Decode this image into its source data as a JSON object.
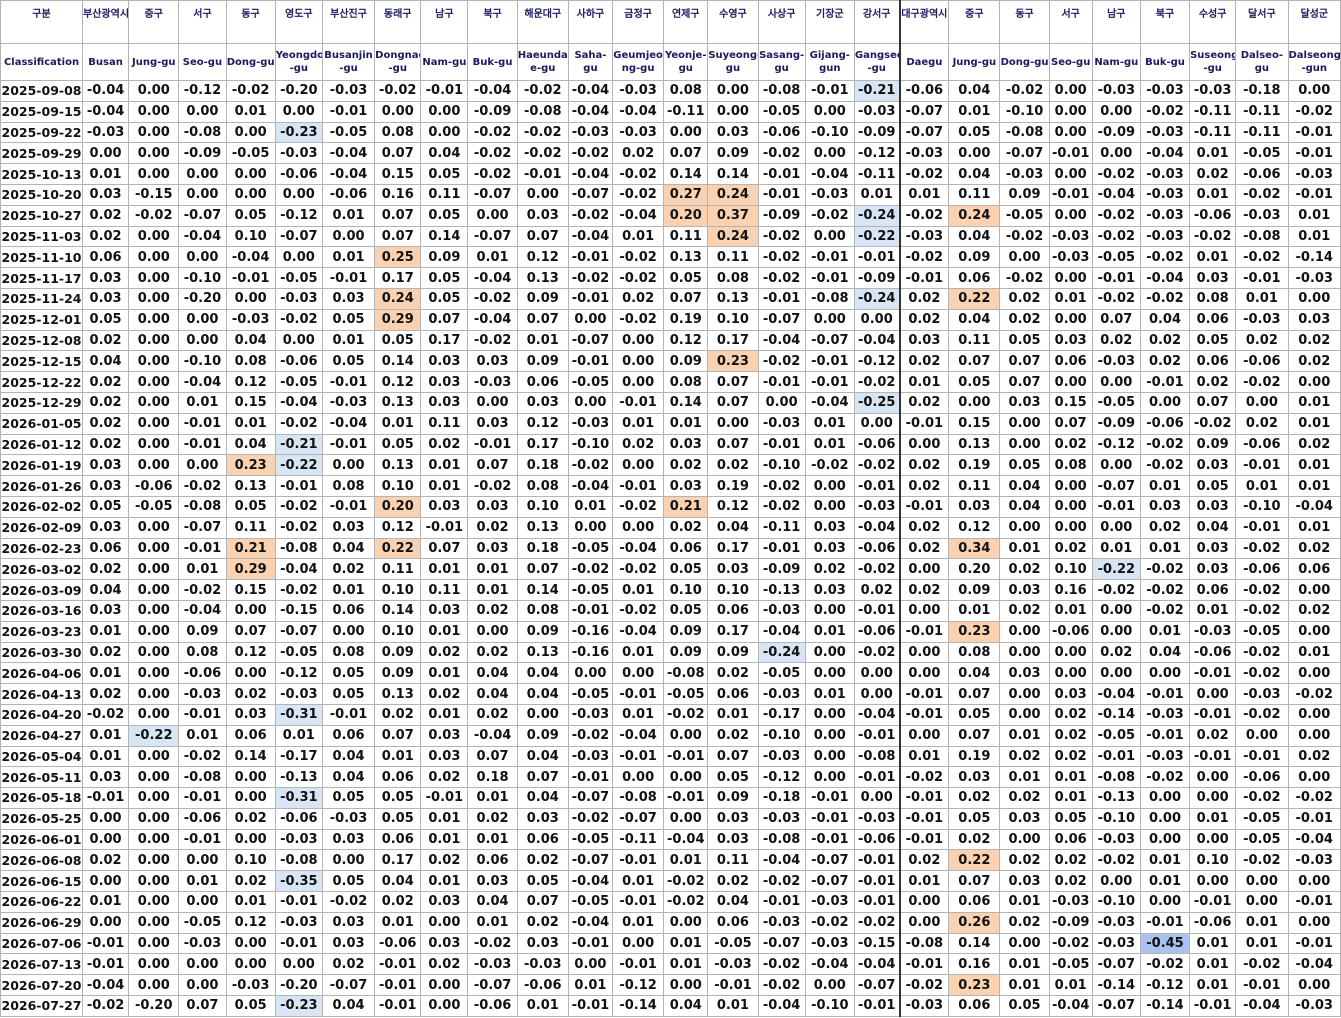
{
  "header_ko": [
    "구분",
    "부산광역시",
    "중구",
    "서구",
    "동구",
    "영도구",
    "부산진구",
    "동래구",
    "남구",
    "북구",
    "해운대구",
    "사하구",
    "금정구",
    "연제구",
    "수영구",
    "사상구",
    "기장군",
    "강서구",
    "대구광역시",
    "중구",
    "동구",
    "서구",
    "남구",
    "북구",
    "수성구",
    "달서구",
    "달성군"
  ],
  "header_en": [
    "Classification",
    "Busan",
    "Jung-gu",
    "Seo-gu",
    "Dong-gu",
    "Yeongdo -gu",
    "Busanjin -gu",
    "Dongnae -gu",
    "Nam-gu",
    "Buk-gu",
    "Haeunda e-gu",
    "Saha-gu",
    "Geumjeo ng-gu",
    "Yeonje- gu",
    "Suyeong- gu",
    "Sasang- gu",
    "Gijang- gun",
    "Gangseo -gu",
    "Daegu",
    "Jung-gu",
    "Dong-gu",
    "Seo-gu",
    "Nam-gu",
    "Buk-gu",
    "Suseong -gu",
    "Dalseo- gu",
    "Dalseong -gun"
  ],
  "rows": [
    [
      "2025-09-08",
      "-0.04",
      "0.00",
      "-0.12",
      "-0.02",
      "-0.20",
      "-0.03",
      "-0.02",
      "-0.01",
      "-0.04",
      "-0.02",
      "-0.04",
      "-0.03",
      "0.08",
      "0.00",
      "-0.08",
      "-0.01",
      "-0.21",
      "-0.06",
      "0.04",
      "-0.02",
      "0.00",
      "-0.03",
      "-0.03",
      "-0.03",
      "-0.18",
      "0.00"
    ],
    [
      "2025-09-15",
      "-0.04",
      "0.00",
      "0.00",
      "0.01",
      "0.00",
      "-0.01",
      "0.00",
      "0.00",
      "-0.09",
      "-0.08",
      "-0.04",
      "-0.04",
      "-0.11",
      "0.00",
      "-0.05",
      "0.00",
      "-0.03",
      "-0.07",
      "0.01",
      "-0.10",
      "0.00",
      "0.00",
      "-0.02",
      "-0.11",
      "-0.11",
      "-0.02"
    ],
    [
      "2025-09-22",
      "-0.03",
      "0.00",
      "-0.08",
      "0.00",
      "-0.23",
      "-0.05",
      "0.08",
      "0.00",
      "-0.02",
      "-0.02",
      "-0.03",
      "-0.03",
      "0.00",
      "0.03",
      "-0.06",
      "-0.10",
      "-0.09",
      "-0.07",
      "0.05",
      "-0.08",
      "0.00",
      "-0.09",
      "-0.03",
      "-0.11",
      "-0.11",
      "-0.01"
    ],
    [
      "2025-09-29",
      "0.00",
      "0.00",
      "-0.09",
      "-0.05",
      "-0.03",
      "-0.04",
      "0.07",
      "0.04",
      "-0.02",
      "-0.02",
      "-0.02",
      "0.02",
      "0.07",
      "0.09",
      "-0.02",
      "0.00",
      "-0.12",
      "-0.03",
      "0.00",
      "-0.07",
      "-0.01",
      "0.00",
      "-0.04",
      "0.01",
      "-0.05",
      "-0.01"
    ],
    [
      "2025-10-13",
      "0.01",
      "0.00",
      "0.00",
      "0.00",
      "-0.06",
      "-0.04",
      "0.15",
      "0.05",
      "-0.02",
      "-0.01",
      "-0.04",
      "-0.02",
      "0.14",
      "0.14",
      "-0.01",
      "-0.04",
      "-0.11",
      "-0.02",
      "0.04",
      "-0.03",
      "0.00",
      "-0.02",
      "-0.03",
      "0.02",
      "-0.06",
      "-0.03"
    ],
    [
      "2025-10-20",
      "0.03",
      "-0.15",
      "0.00",
      "0.00",
      "0.00",
      "-0.06",
      "0.16",
      "0.11",
      "-0.07",
      "0.00",
      "-0.07",
      "-0.02",
      "0.27",
      "0.24",
      "-0.01",
      "-0.03",
      "0.01",
      "0.01",
      "0.11",
      "0.09",
      "-0.01",
      "-0.04",
      "-0.03",
      "0.01",
      "-0.02",
      "-0.01"
    ],
    [
      "2025-10-27",
      "0.02",
      "-0.02",
      "-0.07",
      "0.05",
      "-0.12",
      "0.01",
      "0.07",
      "0.05",
      "0.00",
      "0.03",
      "-0.02",
      "-0.04",
      "0.20",
      "0.37",
      "-0.09",
      "-0.02",
      "-0.24",
      "-0.02",
      "0.24",
      "-0.05",
      "0.00",
      "-0.02",
      "-0.03",
      "-0.06",
      "-0.03",
      "0.01"
    ],
    [
      "2025-11-03",
      "0.02",
      "0.00",
      "-0.04",
      "0.10",
      "-0.07",
      "0.00",
      "0.07",
      "0.14",
      "-0.07",
      "0.07",
      "-0.04",
      "0.01",
      "0.11",
      "0.24",
      "-0.02",
      "0.00",
      "-0.22",
      "-0.03",
      "0.04",
      "-0.02",
      "-0.03",
      "-0.02",
      "-0.03",
      "-0.02",
      "-0.08",
      "0.01"
    ],
    [
      "2025-11-10",
      "0.06",
      "0.00",
      "0.00",
      "-0.04",
      "0.00",
      "0.01",
      "0.25",
      "0.09",
      "0.01",
      "0.12",
      "-0.01",
      "-0.02",
      "0.13",
      "0.11",
      "-0.02",
      "-0.01",
      "-0.01",
      "-0.02",
      "0.09",
      "0.00",
      "-0.03",
      "-0.05",
      "-0.02",
      "0.01",
      "-0.02",
      "-0.14"
    ],
    [
      "2025-11-17",
      "0.03",
      "0.00",
      "-0.10",
      "-0.01",
      "-0.05",
      "-0.01",
      "0.17",
      "0.05",
      "-0.04",
      "0.13",
      "-0.02",
      "-0.02",
      "0.05",
      "0.08",
      "-0.02",
      "-0.01",
      "-0.09",
      "-0.01",
      "0.06",
      "-0.02",
      "0.00",
      "-0.01",
      "-0.04",
      "0.03",
      "-0.01",
      "-0.03"
    ],
    [
      "2025-11-24",
      "0.03",
      "0.00",
      "-0.20",
      "0.00",
      "-0.03",
      "0.03",
      "0.24",
      "0.05",
      "-0.02",
      "0.09",
      "-0.01",
      "0.02",
      "0.07",
      "0.13",
      "-0.01",
      "-0.08",
      "-0.24",
      "0.02",
      "0.22",
      "0.02",
      "0.01",
      "-0.02",
      "-0.02",
      "0.08",
      "0.01",
      "0.00"
    ],
    [
      "2025-12-01",
      "0.05",
      "0.00",
      "0.00",
      "-0.03",
      "-0.02",
      "0.05",
      "0.29",
      "0.07",
      "-0.04",
      "0.07",
      "0.00",
      "-0.02",
      "0.19",
      "0.10",
      "-0.07",
      "0.00",
      "0.00",
      "0.02",
      "0.04",
      "0.02",
      "0.00",
      "0.07",
      "0.04",
      "0.06",
      "-0.03",
      "0.03"
    ],
    [
      "2025-12-08",
      "0.02",
      "0.00",
      "0.00",
      "0.04",
      "0.00",
      "0.01",
      "0.05",
      "0.17",
      "-0.02",
      "0.01",
      "-0.07",
      "0.00",
      "0.12",
      "0.17",
      "-0.04",
      "-0.07",
      "-0.04",
      "0.03",
      "0.11",
      "0.05",
      "0.03",
      "0.02",
      "0.02",
      "0.05",
      "0.02",
      "0.02"
    ],
    [
      "2025-12-15",
      "0.04",
      "0.00",
      "-0.10",
      "0.08",
      "-0.06",
      "0.05",
      "0.14",
      "0.03",
      "0.03",
      "0.09",
      "-0.01",
      "0.00",
      "0.09",
      "0.23",
      "-0.02",
      "-0.01",
      "-0.12",
      "0.02",
      "0.07",
      "0.07",
      "0.06",
      "-0.03",
      "0.02",
      "0.06",
      "-0.06",
      "0.02"
    ],
    [
      "2025-12-22",
      "0.02",
      "0.00",
      "-0.04",
      "0.12",
      "-0.05",
      "-0.01",
      "0.12",
      "0.03",
      "-0.03",
      "0.06",
      "-0.05",
      "0.00",
      "0.08",
      "0.07",
      "-0.01",
      "-0.01",
      "-0.02",
      "0.01",
      "0.05",
      "0.07",
      "0.00",
      "0.00",
      "-0.01",
      "0.02",
      "-0.02",
      "0.00"
    ],
    [
      "2025-12-29",
      "0.02",
      "0.00",
      "0.01",
      "0.15",
      "-0.04",
      "-0.03",
      "0.13",
      "0.03",
      "0.00",
      "0.03",
      "0.00",
      "-0.01",
      "0.14",
      "0.07",
      "0.00",
      "-0.04",
      "-0.25",
      "0.02",
      "0.00",
      "0.03",
      "0.15",
      "-0.05",
      "0.00",
      "0.07",
      "0.00",
      "0.01"
    ],
    [
      "2026-01-05",
      "0.02",
      "0.00",
      "-0.01",
      "0.01",
      "-0.02",
      "-0.04",
      "0.01",
      "0.11",
      "0.03",
      "0.12",
      "-0.03",
      "0.01",
      "0.01",
      "0.00",
      "-0.03",
      "0.01",
      "0.00",
      "-0.01",
      "0.15",
      "0.00",
      "0.07",
      "-0.09",
      "-0.06",
      "-0.02",
      "0.02",
      "0.01"
    ],
    [
      "2026-01-12",
      "0.02",
      "0.00",
      "-0.01",
      "0.04",
      "-0.21",
      "-0.01",
      "0.05",
      "0.02",
      "-0.01",
      "0.17",
      "-0.10",
      "0.02",
      "0.03",
      "0.07",
      "-0.01",
      "0.01",
      "-0.06",
      "0.00",
      "0.13",
      "0.00",
      "0.02",
      "-0.12",
      "-0.02",
      "0.09",
      "-0.06",
      "0.02"
    ],
    [
      "2026-01-19",
      "0.03",
      "0.00",
      "0.00",
      "0.23",
      "-0.22",
      "0.00",
      "0.13",
      "0.01",
      "0.07",
      "0.18",
      "-0.02",
      "0.00",
      "0.02",
      "0.02",
      "-0.10",
      "-0.02",
      "-0.02",
      "0.02",
      "0.19",
      "0.05",
      "0.08",
      "0.00",
      "-0.02",
      "0.03",
      "-0.01",
      "0.01"
    ],
    [
      "2026-01-26",
      "0.03",
      "-0.06",
      "-0.02",
      "0.13",
      "-0.01",
      "0.08",
      "0.10",
      "0.01",
      "-0.02",
      "0.08",
      "-0.04",
      "-0.01",
      "0.03",
      "0.19",
      "-0.02",
      "0.00",
      "-0.01",
      "0.02",
      "0.11",
      "0.04",
      "0.00",
      "-0.07",
      "0.01",
      "0.05",
      "0.01",
      "0.01"
    ],
    [
      "2026-02-02",
      "0.05",
      "-0.05",
      "-0.08",
      "0.05",
      "-0.02",
      "-0.01",
      "0.20",
      "0.03",
      "0.03",
      "0.10",
      "0.01",
      "-0.02",
      "0.21",
      "0.12",
      "-0.02",
      "0.00",
      "-0.03",
      "-0.01",
      "0.03",
      "0.04",
      "0.00",
      "-0.01",
      "0.03",
      "0.03",
      "-0.10",
      "-0.04"
    ],
    [
      "2026-02-09",
      "0.03",
      "0.00",
      "-0.07",
      "0.11",
      "-0.02",
      "0.03",
      "0.12",
      "-0.01",
      "0.02",
      "0.13",
      "0.00",
      "0.00",
      "0.02",
      "0.04",
      "-0.11",
      "0.03",
      "-0.04",
      "0.02",
      "0.12",
      "0.00",
      "0.00",
      "0.00",
      "0.02",
      "0.04",
      "-0.01",
      "0.01"
    ],
    [
      "2026-02-23",
      "0.06",
      "0.00",
      "-0.01",
      "0.21",
      "-0.08",
      "0.04",
      "0.22",
      "0.07",
      "0.03",
      "0.18",
      "-0.05",
      "-0.04",
      "0.06",
      "0.17",
      "-0.01",
      "0.03",
      "-0.06",
      "0.02",
      "0.34",
      "0.01",
      "0.02",
      "0.01",
      "0.01",
      "0.03",
      "-0.02",
      "0.02"
    ],
    [
      "2026-03-02",
      "0.02",
      "0.00",
      "0.01",
      "0.29",
      "-0.04",
      "0.02",
      "0.11",
      "0.01",
      "0.01",
      "0.07",
      "-0.02",
      "-0.02",
      "0.05",
      "0.03",
      "-0.09",
      "0.02",
      "-0.02",
      "0.00",
      "0.20",
      "0.02",
      "0.10",
      "-0.22",
      "-0.02",
      "0.03",
      "-0.06",
      "0.06"
    ],
    [
      "2026-03-09",
      "0.04",
      "0.00",
      "-0.02",
      "0.15",
      "-0.02",
      "0.01",
      "0.10",
      "0.11",
      "0.01",
      "0.14",
      "-0.05",
      "0.01",
      "0.10",
      "0.10",
      "-0.13",
      "0.03",
      "0.02",
      "0.02",
      "0.09",
      "0.03",
      "0.16",
      "-0.02",
      "-0.02",
      "0.06",
      "-0.02",
      "0.00"
    ],
    [
      "2026-03-16",
      "0.03",
      "0.00",
      "-0.04",
      "0.00",
      "-0.15",
      "0.06",
      "0.14",
      "0.03",
      "0.02",
      "0.08",
      "-0.01",
      "-0.02",
      "0.05",
      "0.06",
      "-0.03",
      "0.00",
      "-0.01",
      "0.00",
      "0.01",
      "0.02",
      "0.01",
      "0.00",
      "-0.02",
      "0.01",
      "-0.02",
      "0.02"
    ],
    [
      "2026-03-23",
      "0.01",
      "0.00",
      "0.09",
      "0.07",
      "-0.07",
      "0.00",
      "0.10",
      "0.01",
      "0.00",
      "0.09",
      "-0.16",
      "-0.04",
      "0.09",
      "0.17",
      "-0.04",
      "0.01",
      "-0.06",
      "-0.01",
      "0.23",
      "0.00",
      "-0.06",
      "0.00",
      "0.01",
      "-0.03",
      "-0.05",
      "0.00"
    ],
    [
      "2026-03-30",
      "0.02",
      "0.00",
      "0.08",
      "0.12",
      "-0.05",
      "0.08",
      "0.09",
      "0.02",
      "0.02",
      "0.13",
      "-0.16",
      "0.01",
      "0.09",
      "0.09",
      "-0.24",
      "0.00",
      "-0.02",
      "0.00",
      "0.08",
      "0.00",
      "0.00",
      "0.02",
      "0.04",
      "-0.06",
      "-0.02",
      "0.01"
    ],
    [
      "2026-04-06",
      "0.01",
      "0.00",
      "-0.06",
      "0.00",
      "-0.12",
      "0.05",
      "0.09",
      "0.01",
      "0.04",
      "0.04",
      "0.00",
      "0.00",
      "-0.08",
      "0.02",
      "-0.05",
      "0.00",
      "0.00",
      "0.00",
      "0.04",
      "0.03",
      "0.00",
      "0.00",
      "0.00",
      "-0.01",
      "-0.02",
      "0.00"
    ],
    [
      "2026-04-13",
      "0.02",
      "0.00",
      "-0.03",
      "0.02",
      "-0.03",
      "0.05",
      "0.13",
      "0.02",
      "0.04",
      "0.04",
      "-0.05",
      "-0.01",
      "-0.05",
      "0.06",
      "-0.03",
      "0.01",
      "0.00",
      "-0.01",
      "0.07",
      "0.00",
      "0.03",
      "-0.04",
      "-0.01",
      "0.00",
      "-0.03",
      "-0.02"
    ],
    [
      "2026-04-20",
      "-0.02",
      "0.00",
      "-0.01",
      "0.03",
      "-0.31",
      "-0.01",
      "0.02",
      "0.01",
      "0.02",
      "0.00",
      "-0.03",
      "0.01",
      "-0.02",
      "0.01",
      "-0.17",
      "0.00",
      "-0.04",
      "-0.01",
      "0.05",
      "0.00",
      "0.02",
      "-0.14",
      "-0.03",
      "-0.01",
      "-0.02",
      "0.00"
    ],
    [
      "2026-04-27",
      "0.01",
      "-0.22",
      "0.01",
      "0.06",
      "0.01",
      "0.06",
      "0.07",
      "0.03",
      "-0.04",
      "0.09",
      "-0.02",
      "-0.04",
      "0.00",
      "0.02",
      "-0.10",
      "0.00",
      "-0.01",
      "0.00",
      "0.07",
      "0.01",
      "0.02",
      "-0.05",
      "-0.01",
      "0.02",
      "0.00",
      "0.00"
    ],
    [
      "2026-05-04",
      "0.01",
      "0.00",
      "-0.02",
      "0.14",
      "-0.17",
      "0.04",
      "0.01",
      "0.03",
      "0.07",
      "0.04",
      "-0.03",
      "-0.01",
      "-0.01",
      "0.07",
      "-0.03",
      "0.00",
      "-0.08",
      "0.01",
      "0.19",
      "0.02",
      "0.02",
      "-0.01",
      "-0.03",
      "-0.01",
      "-0.01",
      "0.02"
    ],
    [
      "2026-05-11",
      "0.03",
      "0.00",
      "-0.08",
      "0.00",
      "-0.13",
      "0.04",
      "0.06",
      "0.02",
      "0.18",
      "0.07",
      "-0.01",
      "0.00",
      "0.00",
      "0.05",
      "-0.12",
      "0.00",
      "-0.01",
      "-0.02",
      "0.03",
      "0.01",
      "0.01",
      "-0.08",
      "-0.02",
      "0.00",
      "-0.06",
      "0.00"
    ],
    [
      "2026-05-18",
      "-0.01",
      "0.00",
      "-0.01",
      "0.00",
      "-0.31",
      "0.05",
      "0.05",
      "-0.01",
      "0.01",
      "0.04",
      "-0.07",
      "-0.08",
      "-0.01",
      "0.09",
      "-0.18",
      "-0.01",
      "0.00",
      "-0.01",
      "0.02",
      "0.02",
      "0.01",
      "-0.13",
      "0.00",
      "0.00",
      "-0.02",
      "-0.02"
    ],
    [
      "2026-05-25",
      "0.00",
      "0.00",
      "-0.06",
      "0.02",
      "-0.06",
      "-0.03",
      "0.05",
      "0.01",
      "0.02",
      "0.03",
      "-0.02",
      "-0.07",
      "0.00",
      "0.03",
      "-0.03",
      "-0.01",
      "-0.03",
      "-0.01",
      "0.05",
      "0.03",
      "0.05",
      "-0.10",
      "0.00",
      "0.01",
      "-0.05",
      "-0.01"
    ],
    [
      "2026-06-01",
      "0.00",
      "0.00",
      "-0.01",
      "0.00",
      "-0.03",
      "0.03",
      "0.06",
      "0.01",
      "0.01",
      "0.06",
      "-0.05",
      "-0.11",
      "-0.04",
      "0.03",
      "-0.08",
      "-0.01",
      "-0.06",
      "-0.01",
      "0.02",
      "0.00",
      "0.06",
      "-0.03",
      "0.00",
      "0.00",
      "-0.05",
      "-0.04"
    ],
    [
      "2026-06-08",
      "0.02",
      "0.00",
      "0.00",
      "0.10",
      "-0.08",
      "0.00",
      "0.17",
      "0.02",
      "0.06",
      "0.02",
      "-0.07",
      "-0.01",
      "0.01",
      "0.11",
      "-0.04",
      "-0.07",
      "-0.01",
      "0.02",
      "0.22",
      "0.02",
      "0.02",
      "-0.02",
      "0.01",
      "0.10",
      "-0.02",
      "-0.03"
    ],
    [
      "2026-06-15",
      "0.00",
      "0.00",
      "0.01",
      "0.02",
      "-0.35",
      "0.05",
      "0.04",
      "0.01",
      "0.03",
      "0.05",
      "-0.04",
      "0.01",
      "-0.02",
      "0.02",
      "-0.02",
      "-0.07",
      "-0.01",
      "0.01",
      "0.07",
      "0.03",
      "0.02",
      "0.00",
      "0.01",
      "0.00",
      "0.00",
      "0.00"
    ],
    [
      "2026-06-22",
      "0.01",
      "0.00",
      "0.00",
      "0.01",
      "-0.01",
      "-0.02",
      "0.02",
      "0.03",
      "0.04",
      "0.07",
      "-0.05",
      "-0.01",
      "-0.02",
      "0.04",
      "-0.01",
      "-0.03",
      "-0.01",
      "0.00",
      "0.06",
      "0.01",
      "-0.03",
      "-0.10",
      "0.00",
      "-0.01",
      "0.00",
      "-0.01"
    ],
    [
      "2026-06-29",
      "0.00",
      "0.00",
      "-0.05",
      "0.12",
      "-0.03",
      "0.03",
      "0.01",
      "0.00",
      "0.01",
      "0.02",
      "-0.04",
      "0.01",
      "0.00",
      "0.06",
      "-0.03",
      "-0.02",
      "-0.02",
      "0.00",
      "0.26",
      "0.02",
      "-0.09",
      "-0.03",
      "-0.01",
      "-0.06",
      "0.01",
      "0.00"
    ],
    [
      "2026-07-06",
      "-0.01",
      "0.00",
      "-0.03",
      "0.00",
      "-0.01",
      "0.03",
      "-0.06",
      "0.03",
      "-0.02",
      "0.03",
      "-0.01",
      "0.00",
      "0.01",
      "-0.05",
      "-0.07",
      "-0.03",
      "-0.15",
      "-0.08",
      "0.14",
      "0.00",
      "-0.02",
      "-0.03",
      "-0.45",
      "0.01",
      "0.01",
      "-0.01"
    ],
    [
      "2026-07-13",
      "-0.01",
      "0.00",
      "0.00",
      "0.00",
      "0.00",
      "0.02",
      "-0.01",
      "0.02",
      "-0.03",
      "-0.03",
      "0.00",
      "-0.01",
      "0.01",
      "-0.03",
      "-0.02",
      "-0.04",
      "-0.04",
      "-0.01",
      "0.16",
      "0.01",
      "-0.05",
      "-0.07",
      "-0.02",
      "0.01",
      "-0.02",
      "-0.04"
    ],
    [
      "2026-07-20",
      "-0.04",
      "0.00",
      "0.00",
      "-0.03",
      "-0.20",
      "-0.07",
      "-0.01",
      "0.00",
      "-0.07",
      "-0.06",
      "0.01",
      "-0.12",
      "0.00",
      "-0.01",
      "-0.02",
      "0.00",
      "-0.07",
      "-0.02",
      "0.23",
      "0.01",
      "0.01",
      "-0.14",
      "-0.12",
      "0.01",
      "-0.01",
      "0.00"
    ],
    [
      "2026-07-27",
      "-0.02",
      "-0.20",
      "0.07",
      "0.05",
      "-0.23",
      "0.04",
      "-0.01",
      "0.00",
      "-0.06",
      "0.01",
      "-0.01",
      "-0.14",
      "0.04",
      "0.01",
      "-0.04",
      "-0.10",
      "-0.01",
      "-0.03",
      "0.06",
      "0.05",
      "-0.04",
      "-0.07",
      "-0.14",
      "-0.01",
      "-0.04",
      "-0.03"
    ]
  ],
  "highlight_colors": {
    "up": "#fad2b2",
    "down": "#d7e5f4",
    "strong_down": "#a9c3ee"
  }
}
